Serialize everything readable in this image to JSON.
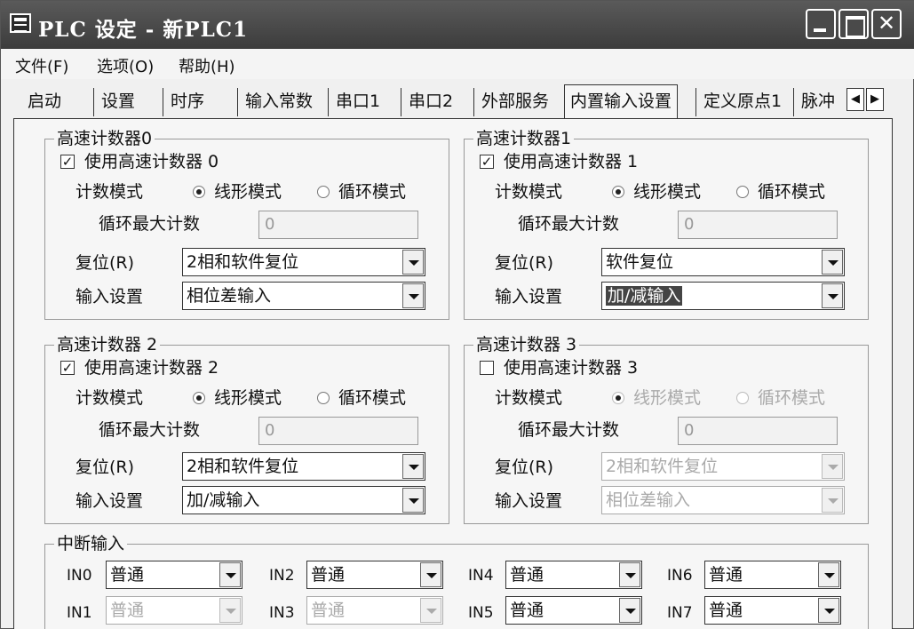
{
  "window": {
    "title": "PLC 设定 - 新PLC1"
  },
  "menu": [
    "文件(F)",
    "选项(O)",
    "帮助(H)"
  ],
  "tabs": [
    "启动",
    "设置",
    "时序",
    "输入常数",
    "串口1",
    "串口2",
    "外部服务",
    "内置输入设置",
    "定义原点1",
    "脉冲"
  ],
  "tabs_active": "内置输入设置",
  "labels": {
    "count_mode": "计数模式",
    "linear": "线形模式",
    "loop": "循环模式",
    "loop_max": "循环最大计数",
    "reset": "复位(R)",
    "input_setting": "输入设置"
  },
  "counters": [
    {
      "title": "高速计数器0",
      "check_label": "使用高速计数器 0",
      "checked": true,
      "checked_mark": "✓",
      "mode": "线形模式",
      "loop_max": "0",
      "reset": "2相和软件复位",
      "input": "相位差输入"
    },
    {
      "title": "高速计数器1",
      "check_label": "使用高速计数器 1",
      "checked": true,
      "checked_mark": "✓",
      "mode": "线形模式",
      "loop_max": "0",
      "reset": "软件复位",
      "input": "加/减输入"
    },
    {
      "title": "高速计数器 2",
      "check_label": "使用高速计数器 2",
      "checked": true,
      "checked_mark": "✓",
      "mode": "线形模式",
      "loop_max": "0",
      "reset": "2相和软件复位",
      "input": "加/减输入"
    },
    {
      "title": "高速计数器 3",
      "check_label": "使用高速计数器 3",
      "checked": false,
      "checked_mark": "",
      "mode": "线形模式",
      "loop_max": "0",
      "reset": "2相和软件复位",
      "input": "相位差输入"
    }
  ],
  "interrupt": {
    "title": "中断输入",
    "inputs": [
      {
        "label": "IN0",
        "value": "普通",
        "enabled": true
      },
      {
        "label": "IN1",
        "value": "普通",
        "enabled": false
      },
      {
        "label": "IN2",
        "value": "普通",
        "enabled": true
      },
      {
        "label": "IN3",
        "value": "普通",
        "enabled": false
      },
      {
        "label": "IN4",
        "value": "普通",
        "enabled": true
      },
      {
        "label": "IN5",
        "value": "普通",
        "enabled": true
      },
      {
        "label": "IN6",
        "value": "普通",
        "enabled": true
      },
      {
        "label": "IN7",
        "value": "普通",
        "enabled": true
      }
    ]
  }
}
